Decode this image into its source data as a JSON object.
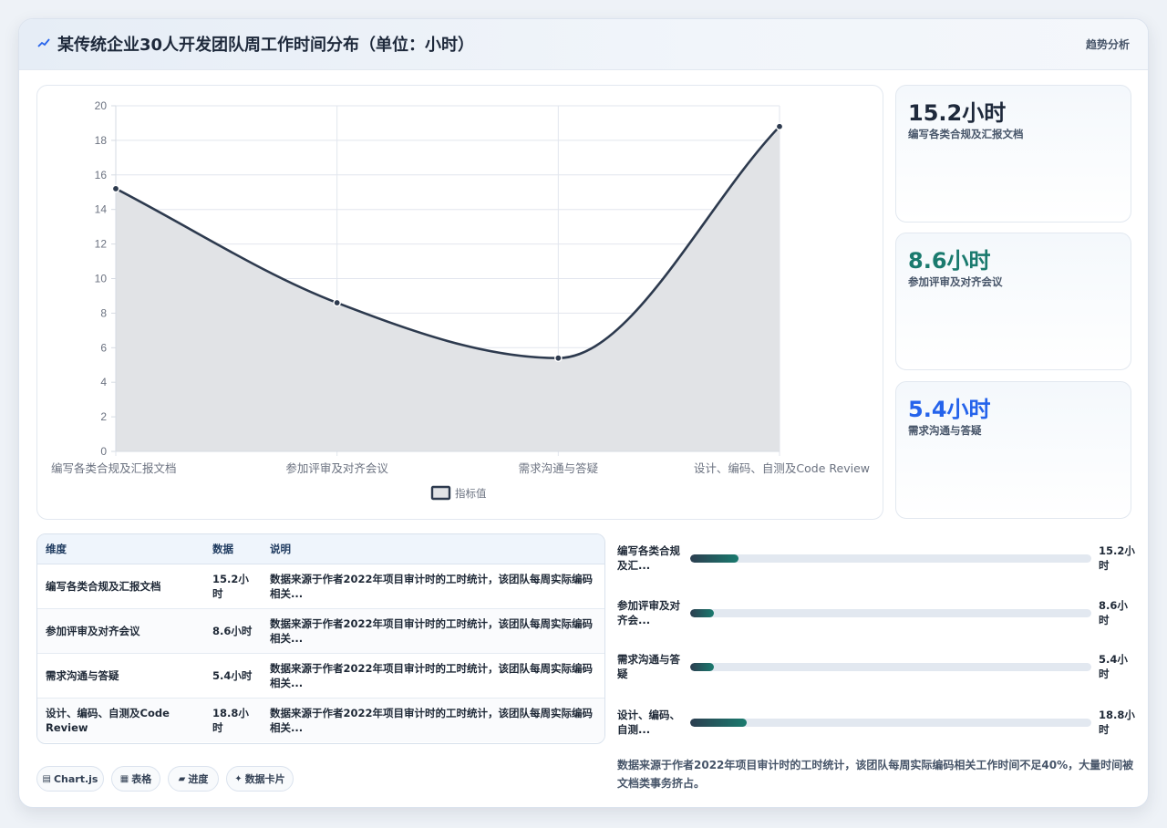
{
  "header": {
    "title": "某传统企业30人开发团队周工作时间分布（单位：小时）",
    "action_label": "趋势分析"
  },
  "chart_data": {
    "type": "area",
    "categories": [
      "编写各类合规及汇报文档",
      "参加评审及对齐会议",
      "需求沟通与答疑",
      "设计、编码、自测及Code Review"
    ],
    "series": [
      {
        "name": "指标值",
        "values": [
          15.2,
          8.6,
          5.4,
          18.8
        ]
      }
    ],
    "yticks": [
      "0",
      "2",
      "4",
      "6",
      "8",
      "10",
      "12",
      "14",
      "16",
      "18",
      "20"
    ],
    "ylim": [
      0,
      20
    ],
    "grid": true,
    "legend_position": "bottom",
    "line_color": "#2d3a4e",
    "fill_color": "#e1e3e6"
  },
  "stats": [
    {
      "value": "15.2小时",
      "label": "编写各类合规及汇报文档",
      "color": "#1e293b"
    },
    {
      "value": "8.6小时",
      "label": "参加评审及对齐会议",
      "color": "#1a7a6e"
    },
    {
      "value": "5.4小时",
      "label": "需求沟通与答疑",
      "color": "#2563eb"
    }
  ],
  "table": {
    "headers": [
      "维度",
      "数据",
      "说明"
    ],
    "rows": [
      [
        "编写各类合规及汇报文档",
        "15.2小时",
        "数据来源于作者2022年项目审计时的工时统计，该团队每周实际编码相关..."
      ],
      [
        "参加评审及对齐会议",
        "8.6小时",
        "数据来源于作者2022年项目审计时的工时统计，该团队每周实际编码相关..."
      ],
      [
        "需求沟通与答疑",
        "5.4小时",
        "数据来源于作者2022年项目审计时的工时统计，该团队每周实际编码相关..."
      ],
      [
        "设计、编码、自测及Code Review",
        "18.8小时",
        "数据来源于作者2022年项目审计时的工时统计，该团队每周实际编码相关..."
      ]
    ]
  },
  "chips": [
    {
      "icon": "▤",
      "label": "Chart.js"
    },
    {
      "icon": "▦",
      "label": "表格"
    },
    {
      "icon": "▰",
      "label": "进度"
    },
    {
      "icon": "✦",
      "label": "数据卡片"
    }
  ],
  "progress": [
    {
      "label": "编写各类合规及汇...",
      "value": "15.2小时",
      "fraction": 0.12
    },
    {
      "label": "参加评审及对齐会...",
      "value": "8.6小时",
      "fraction": 0.06
    },
    {
      "label": "需求沟通与答疑",
      "value": "5.4小时",
      "fraction": 0.06
    },
    {
      "label": "设计、编码、自测...",
      "value": "18.8小时",
      "fraction": 0.14
    }
  ],
  "note": "数据来源于作者2022年项目审计时的工时统计，该团队每周实际编码相关工作时间不足40%，大量时间被文档类事务挤占。"
}
